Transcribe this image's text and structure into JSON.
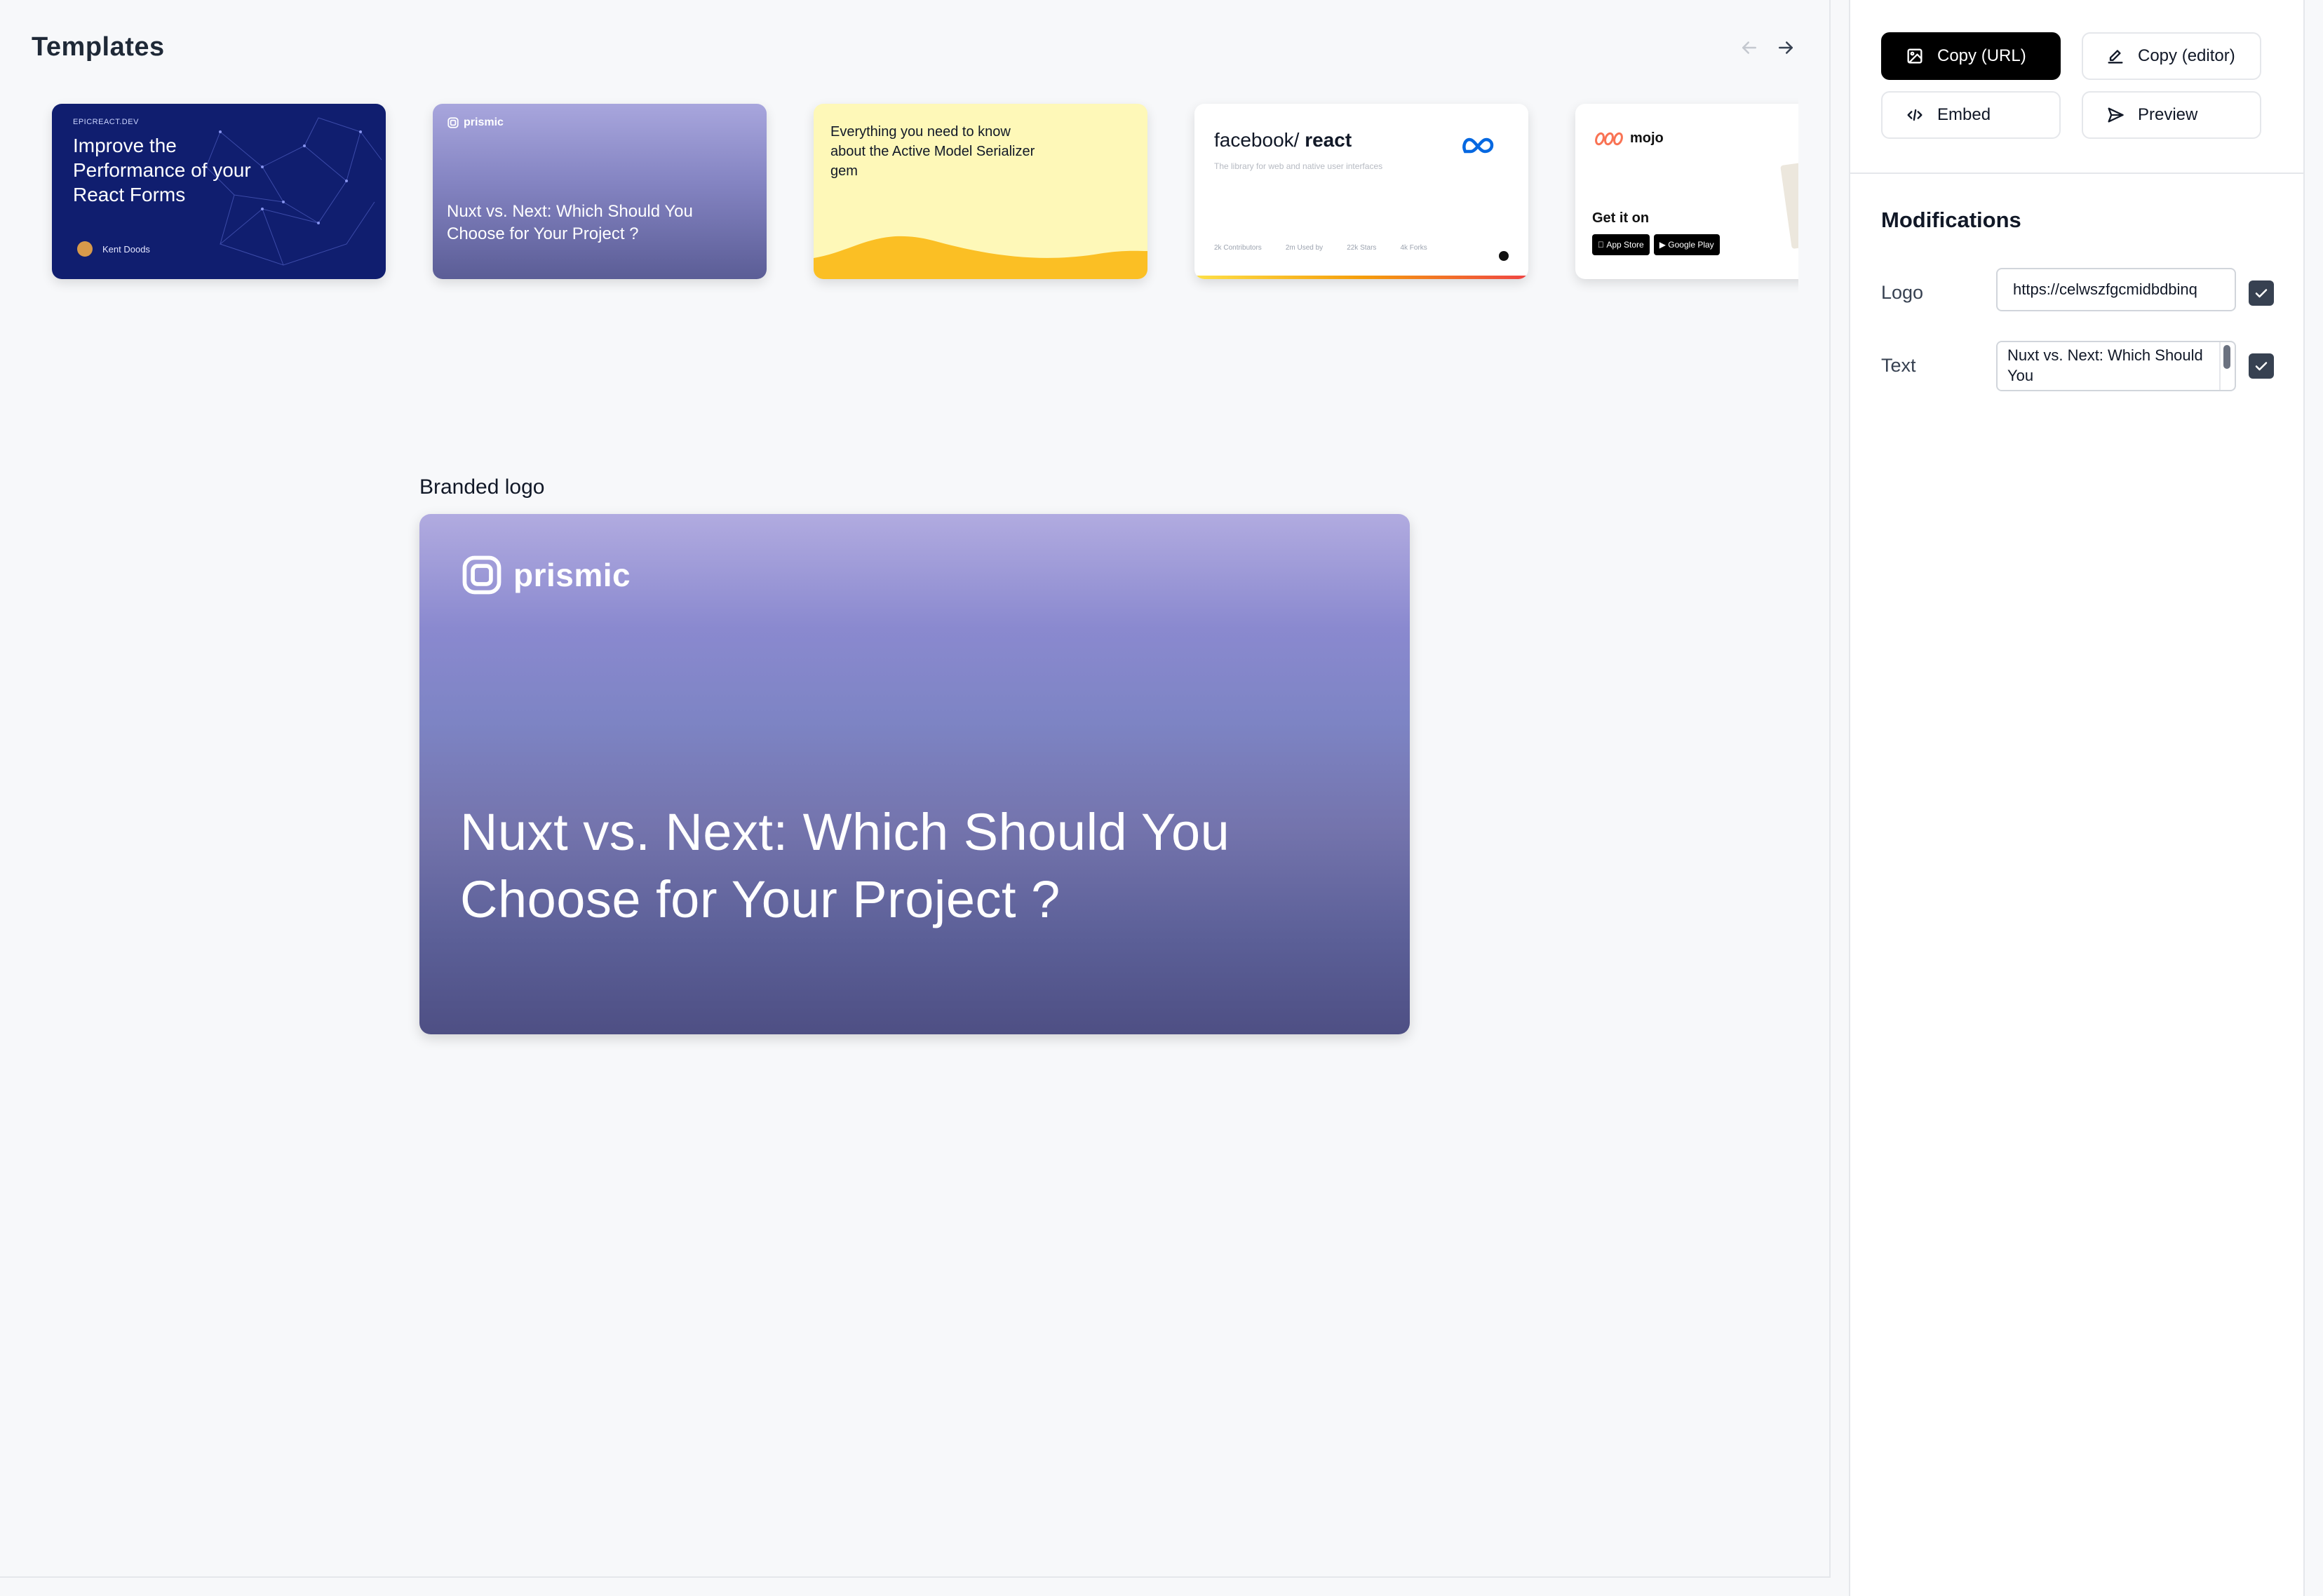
{
  "header": {
    "title": "Templates",
    "prev_icon": "arrow-left-icon",
    "next_icon": "arrow-right-icon"
  },
  "templates": [
    {
      "eyebrow": "EPICREACT.DEV",
      "title": "Improve the Performance of your React Forms",
      "author": "Kent Doods"
    },
    {
      "logo": "prismic",
      "title": "Nuxt vs. Next: Which Should You Choose for Your Project ?"
    },
    {
      "title": "Everything you need to know about the Active Model Serializer gem"
    },
    {
      "title_owner": "facebook/",
      "title_repo": "react",
      "subtitle": "The library for web and native user interfaces",
      "stats": [
        {
          "value": "2k",
          "label": "Contributors"
        },
        {
          "value": "2m",
          "label": "Used by"
        },
        {
          "value": "22k",
          "label": "Stars"
        },
        {
          "value": "4k",
          "label": "Forks"
        }
      ]
    },
    {
      "brand": "mojo",
      "cta": "Get it on",
      "badges": [
        "App Store",
        "Google Play"
      ]
    }
  ],
  "preview": {
    "label": "Branded logo",
    "logo_text": "prismic",
    "text": "Nuxt vs. Next: Which Should You Choose for Your Project ?"
  },
  "actions": {
    "copy_url": "Copy (URL)",
    "copy_editor": "Copy (editor)",
    "embed": "Embed",
    "preview": "Preview"
  },
  "modifications": {
    "title": "Modifications",
    "logo_label": "Logo",
    "logo_value": "https://celwszfgcmidbdbinq",
    "text_label": "Text",
    "text_value": "Nuxt vs. Next: Which Should You",
    "logo_enabled": true,
    "text_enabled": true
  },
  "colors": {
    "primary_button": "#000000",
    "checkbox": "#374151",
    "preview_gradient_top": "#b1abe0",
    "preview_gradient_bottom": "#4e4f84"
  }
}
